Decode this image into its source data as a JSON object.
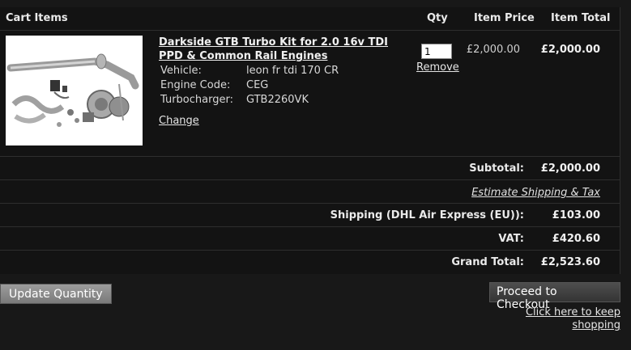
{
  "header": {
    "cart_items": "Cart Items",
    "qty": "Qty",
    "item_price": "Item Price",
    "item_total": "Item Total"
  },
  "item": {
    "title": "Darkside GTB Turbo Kit for 2.0 16v TDI PPD & Common Rail Engines",
    "options": [
      {
        "label": "Vehicle:",
        "value": "leon fr tdi 170 CR"
      },
      {
        "label": "Engine Code:",
        "value": "CEG"
      },
      {
        "label": "Turbocharger:",
        "value": "GTB2260VK"
      }
    ],
    "change": "Change",
    "qty": "1",
    "remove": "Remove",
    "price": "£2,000.00",
    "total": "£2,000.00"
  },
  "summary": {
    "subtotal_label": "Subtotal:",
    "subtotal_value": "£2,000.00",
    "estimate": "Estimate Shipping & Tax",
    "shipping_label": "Shipping (DHL Air Express (EU)):",
    "shipping_value": "£103.00",
    "vat_label": "VAT:",
    "vat_value": "£420.60",
    "grand_label": "Grand Total:",
    "grand_value": "£2,523.60"
  },
  "actions": {
    "update": "Update Quantity",
    "checkout": "Proceed to Checkout",
    "keep_shopping": "Click here to keep shopping"
  },
  "colors": {
    "background": "#181818",
    "panel": "#131313",
    "update_button": "#8a8a8a",
    "checkout_button": "#3e3e3e"
  }
}
